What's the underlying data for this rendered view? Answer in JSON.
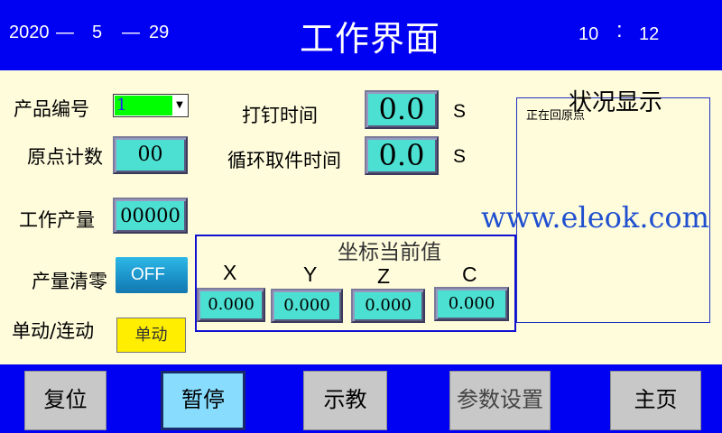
{
  "header": {
    "date_year": "2020",
    "date_sep1": "—",
    "date_month": "5",
    "date_sep2": "—",
    "date_day": "29",
    "title": "工作界面",
    "time_hour": "10",
    "time_sep": ":",
    "time_minute": "12"
  },
  "left": {
    "product_no_label": "产品编号",
    "product_no_value": "1",
    "origin_count_label": "原点计数",
    "origin_count_value": "00",
    "output_label": "工作产量",
    "output_value": "00000",
    "clear_label": "产量清零",
    "clear_toggle": "OFF",
    "mode_label": "单动/连动",
    "mode_button": "单动"
  },
  "center": {
    "nail_time_label": "打钉时间",
    "nail_time_value": "0.0",
    "nail_time_unit": "S",
    "cycle_time_label": "循环取件时间",
    "cycle_time_value": "0.0",
    "cycle_time_unit": "S"
  },
  "coords": {
    "title": "坐标当前值",
    "axes": [
      {
        "label": "X",
        "value": "0.000"
      },
      {
        "label": "Y",
        "value": "0.000"
      },
      {
        "label": "Z",
        "value": "0.000"
      },
      {
        "label": "C",
        "value": "0.000"
      }
    ]
  },
  "status": {
    "title": "状况显示",
    "message": "正在回原点"
  },
  "watermark": "www.eleok.com",
  "footer": {
    "buttons": [
      {
        "label": "复位"
      },
      {
        "label": "暂停"
      },
      {
        "label": "示教"
      },
      {
        "label": "参数设置"
      },
      {
        "label": "主页"
      }
    ]
  },
  "colors": {
    "header_bg": "#0000F2",
    "page_bg": "#FFFCDC",
    "value_box": "#4CE0D2",
    "mode_button": "#FFEE00",
    "active_footer_button": "#88DDFF"
  }
}
